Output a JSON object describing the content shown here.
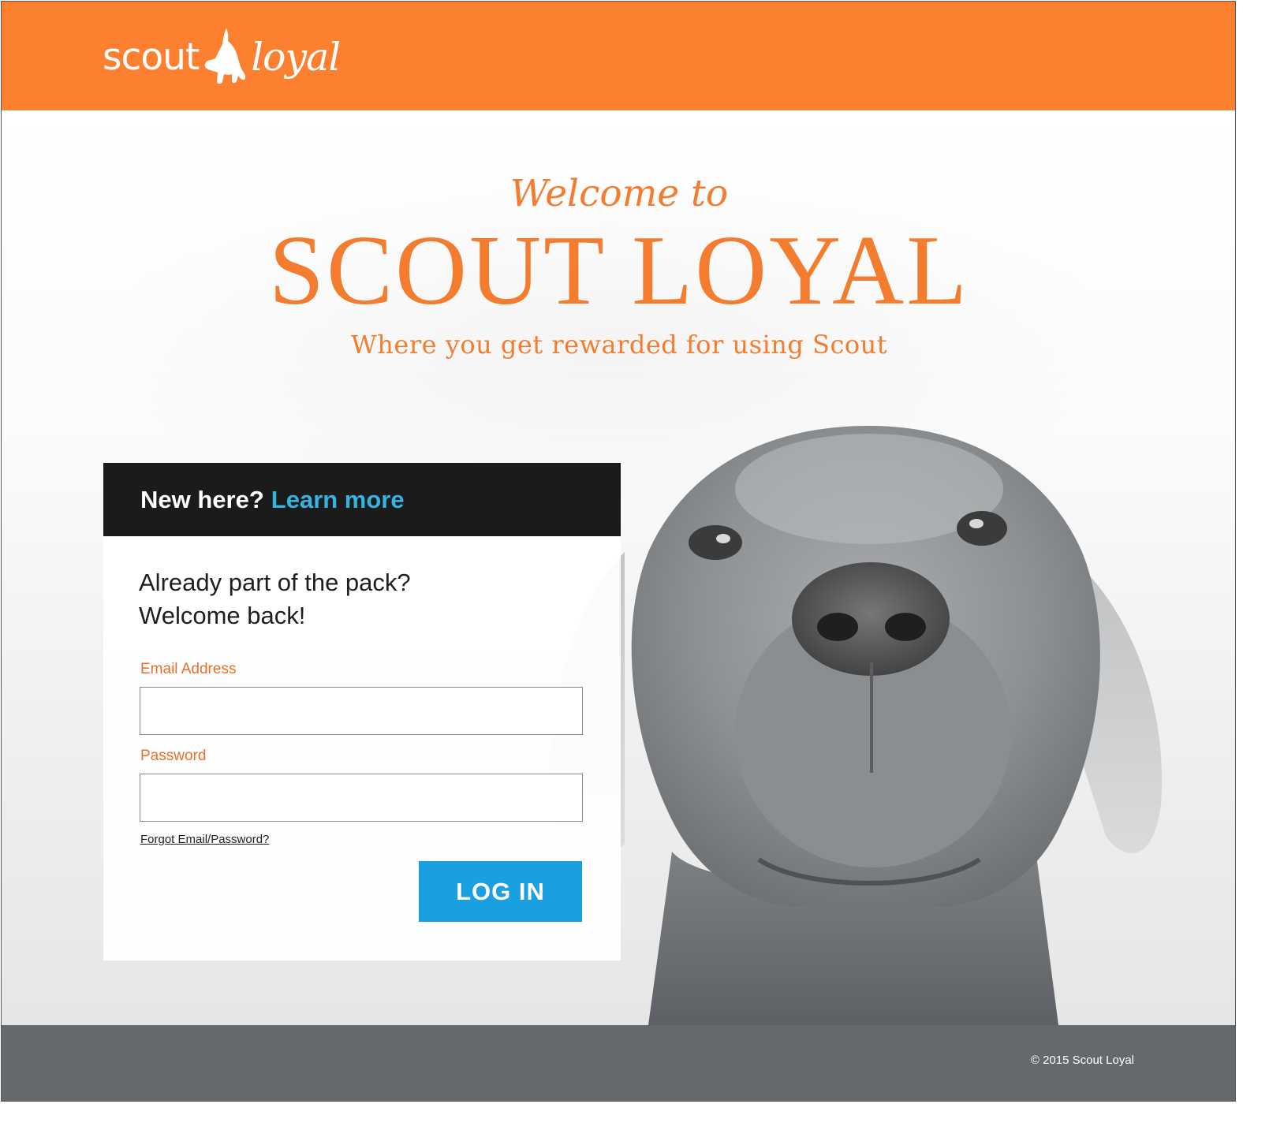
{
  "header": {
    "logo": {
      "word1": "scout",
      "word2": "loyal"
    },
    "color": "#fd7f30"
  },
  "hero": {
    "welcome_to": "Welcome to",
    "title": "SCOUT LOYAL",
    "tagline": "Where you get rewarded for using Scout"
  },
  "login_card": {
    "new_here": "New here?",
    "learn_more": "Learn more",
    "greeting_line1": "Already part of the pack?",
    "greeting_line2": "Welcome back!",
    "email_label": "Email Address",
    "email_value": "",
    "password_label": "Password",
    "password_value": "",
    "forgot_link": "Forgot Email/Password?",
    "login_button": "LOG IN"
  },
  "footer": {
    "copyright": "© 2015 Scout Loyal"
  },
  "colors": {
    "brand_orange": "#fd7f30",
    "title_orange": "#f47c2f",
    "link_blue": "#37b3e2",
    "button_blue": "#1aa0e0",
    "footer_gray": "#66696c",
    "card_header": "#1b1b1b"
  },
  "icons": {
    "logo_mark": "dog-silhouette-icon"
  }
}
